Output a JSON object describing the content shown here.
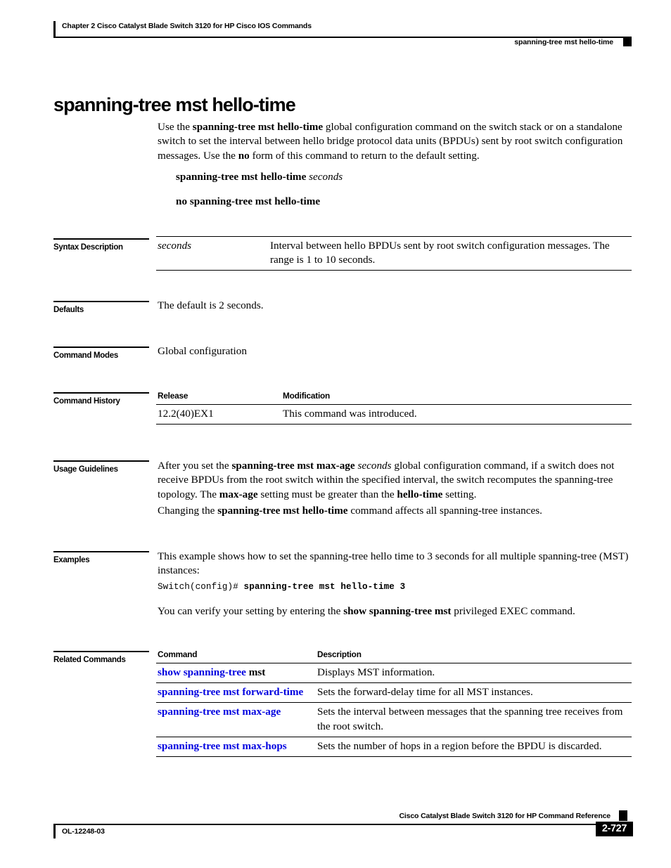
{
  "header": {
    "chapter": "Chapter  2 Cisco Catalyst Blade Switch 3120 for HP Cisco IOS Commands",
    "running_command": "spanning-tree mst hello-time"
  },
  "title": "spanning-tree mst hello-time",
  "intro": {
    "p1_a": "Use the ",
    "p1_b": "spanning-tree mst hello-time",
    "p1_c": " global configuration command on the switch stack or on a standalone switch to set the interval between hello bridge protocol data units (BPDUs) sent by root switch configuration messages. Use the ",
    "p1_d": "no",
    "p1_e": " form of this command to return to the default setting.",
    "syntax_line": "spanning-tree mst hello-time",
    "syntax_arg": "seconds",
    "no_form": "no spanning-tree mst hello-time"
  },
  "sections": {
    "syntax_description": "Syntax Description",
    "defaults": "Defaults",
    "command_modes": "Command Modes",
    "command_history": "Command History",
    "usage_guidelines": "Usage Guidelines",
    "examples": "Examples",
    "related_commands": "Related Commands"
  },
  "syntax_table": {
    "rows": [
      {
        "term": "seconds",
        "description": "Interval between hello BPDUs sent by root switch configuration messages. The range is 1 to 10 seconds."
      }
    ]
  },
  "defaults": {
    "text": "The default is 2 seconds."
  },
  "command_modes": {
    "text": "Global configuration"
  },
  "command_history": {
    "headers": [
      "Release",
      "Modification"
    ],
    "rows": [
      {
        "release": "12.2(40)EX1",
        "modification": "This command was introduced."
      }
    ]
  },
  "usage_guidelines": {
    "p1_a": "After you set the ",
    "p1_b": "spanning-tree mst max-age",
    "p1_c": "seconds",
    "p1_d": " global configuration command, if a switch does not receive BPDUs from the root switch within the specified interval, the switch recomputes the spanning-tree topology. The ",
    "p1_e": "max-age",
    "p1_f": " setting must be greater than the ",
    "p1_g": "hello-time",
    "p1_h": " setting.",
    "p2_a": "Changing the ",
    "p2_b": "spanning-tree mst hello-time",
    "p2_c": " command affects all spanning-tree instances."
  },
  "examples": {
    "p1": "This example shows how to set the spanning-tree hello time to 3 seconds for all multiple spanning-tree (MST) instances:",
    "code_prompt": "Switch(config)# ",
    "code_command": "spanning-tree mst hello-time 3",
    "p2_a": "You can verify your setting by entering the ",
    "p2_b": "show spanning-tree mst",
    "p2_c": " privileged EXEC command."
  },
  "related_commands": {
    "headers": [
      "Command",
      "Description"
    ],
    "rows": [
      {
        "command_link": "show spanning-tree",
        "command_plain": " mst",
        "description": "Displays MST information."
      },
      {
        "command_link": "spanning-tree mst forward-time",
        "command_plain": "",
        "description": "Sets the forward-delay time for all MST instances."
      },
      {
        "command_link": "spanning-tree mst max-age",
        "command_plain": "",
        "description": "Sets the interval between messages that the spanning tree receives from the root switch."
      },
      {
        "command_link": "spanning-tree mst max-hops",
        "command_plain": "",
        "description": "Sets the number of hops in a region before the BPDU is discarded."
      }
    ]
  },
  "footer": {
    "book_title": "Cisco Catalyst Blade Switch 3120 for HP Command Reference",
    "doc_id": "OL-12248-03",
    "page_number": "2-727"
  },
  "colors": {
    "link_blue": "#0000E0",
    "text_black": "#000000",
    "page_background": "#FFFFFF"
  }
}
